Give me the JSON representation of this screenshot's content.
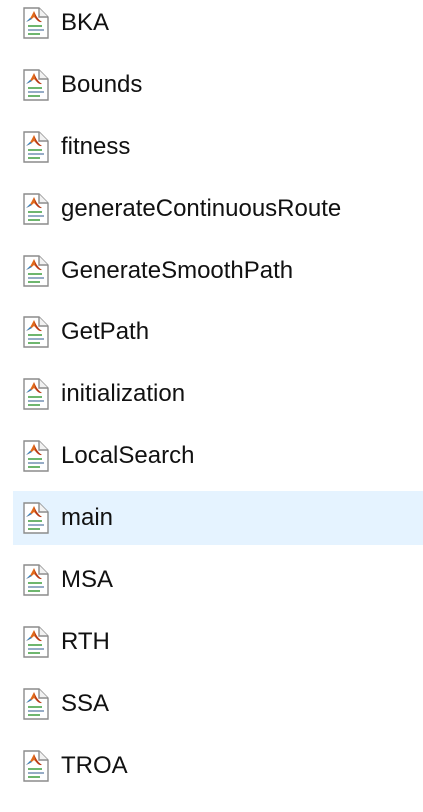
{
  "files": [
    {
      "name": "BKA",
      "icon": "matlab-script-icon",
      "selected": false
    },
    {
      "name": "Bounds",
      "icon": "matlab-script-icon",
      "selected": false
    },
    {
      "name": "fitness",
      "icon": "matlab-script-icon",
      "selected": false
    },
    {
      "name": "generateContinuousRoute",
      "icon": "matlab-script-icon",
      "selected": false
    },
    {
      "name": "GenerateSmoothPath",
      "icon": "matlab-script-icon",
      "selected": false
    },
    {
      "name": "GetPath",
      "icon": "matlab-script-icon",
      "selected": false
    },
    {
      "name": "initialization",
      "icon": "matlab-script-icon",
      "selected": false
    },
    {
      "name": "LocalSearch",
      "icon": "matlab-script-icon",
      "selected": false
    },
    {
      "name": "main",
      "icon": "matlab-script-icon",
      "selected": true
    },
    {
      "name": "MSA",
      "icon": "matlab-script-icon",
      "selected": false
    },
    {
      "name": "RTH",
      "icon": "matlab-script-icon",
      "selected": false
    },
    {
      "name": "SSA",
      "icon": "matlab-script-icon",
      "selected": false
    },
    {
      "name": "TROA",
      "icon": "matlab-script-icon",
      "selected": false
    }
  ],
  "colors": {
    "selection_background": "#e5f3ff",
    "text": "#111111",
    "matlab_orange": "#e16a1b",
    "matlab_red": "#b83b16",
    "page_line_green": "#4aa44a"
  }
}
